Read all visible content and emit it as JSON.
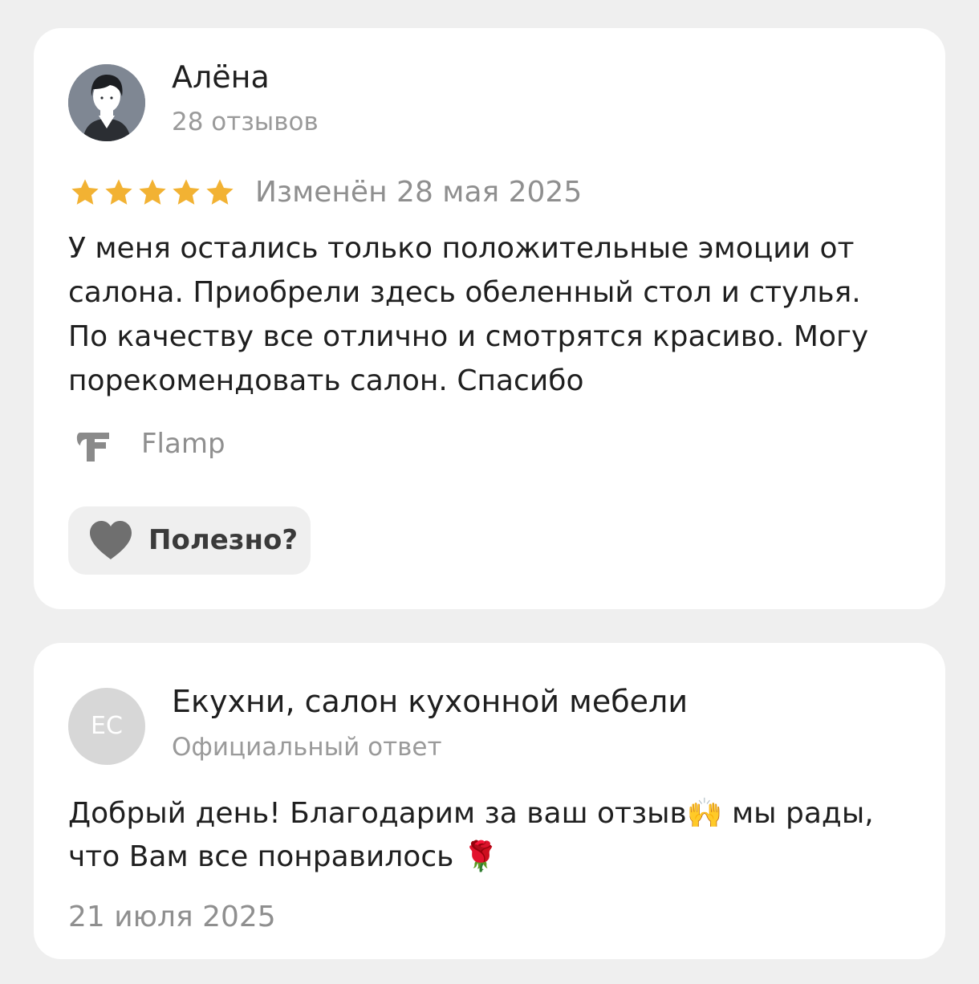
{
  "review": {
    "author_name": "Алёна",
    "author_reviews": "28 отзывов",
    "rating": 5,
    "rating_max": 5,
    "star_color": "#f2b233",
    "edited_date": "Изменён 28 мая 2025",
    "text": "У меня остались только положительные эмоции от\nсалона. Приобрели здесь обеленный стол и стулья.\nПо качеству все отлично и смотрятся красиво. Могу\nпорекомендовать салон. Спасибо",
    "source_icon": "flamp-logo-icon",
    "source_name": "Flamp",
    "useful_icon": "heart-icon",
    "useful_label": "Полезно?"
  },
  "reply": {
    "avatar_initials": "ЕС",
    "author_name": "Екухни, салон кухонной мебели",
    "author_sub": "Официальный ответ",
    "text": "Добрый день! Благодарим за ваш отзыв🙌 мы рады,\nчто Вам все понравилось 🌹",
    "date": "21 июля 2025"
  }
}
